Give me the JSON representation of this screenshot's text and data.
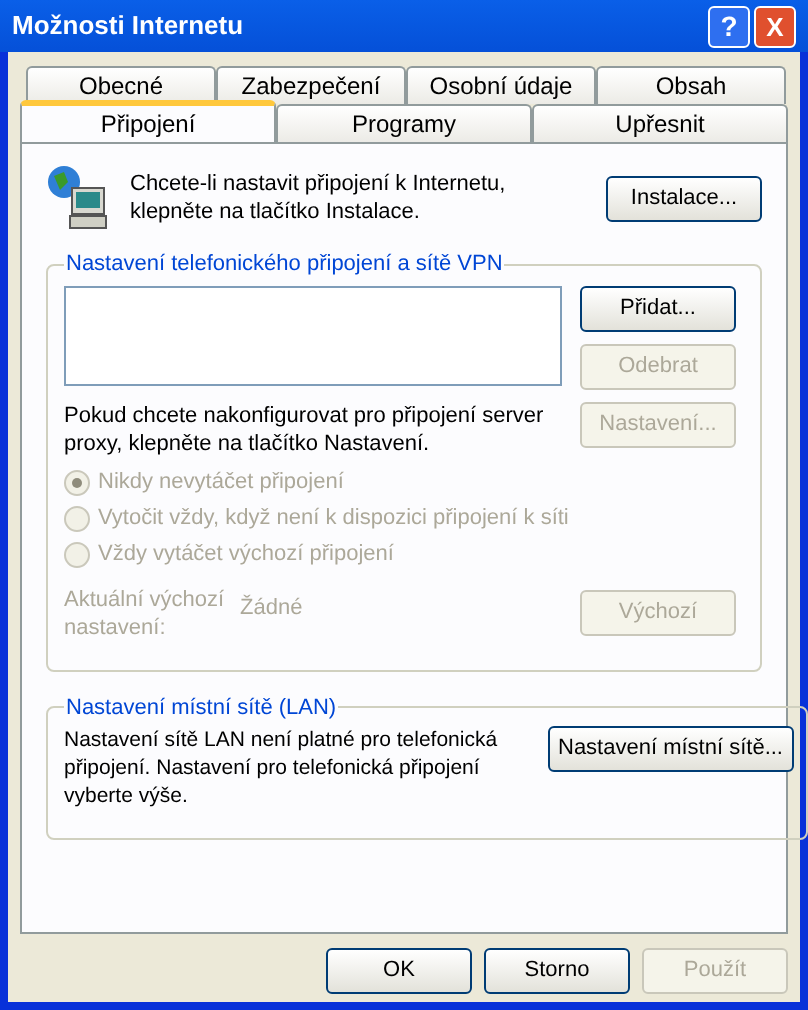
{
  "window": {
    "title": "Možnosti Internetu",
    "help_button": "?",
    "close_button": "X"
  },
  "tab_rows": [
    [
      {
        "label": "Obecné",
        "selected": false
      },
      {
        "label": "Zabezpečení",
        "selected": false
      },
      {
        "label": "Osobní údaje",
        "selected": false
      },
      {
        "label": "Obsah",
        "selected": false
      }
    ],
    [
      {
        "label": "Připojení",
        "selected": true
      },
      {
        "label": "Programy",
        "selected": false
      },
      {
        "label": "Upřesnit",
        "selected": false
      }
    ]
  ],
  "setup": {
    "text": "Chcete-li nastavit připojení k Internetu, klepněte na tlačítko Instalace.",
    "button": {
      "label": "Instalace...",
      "disabled": false
    }
  },
  "dialup_group": {
    "title": "Nastavení telefonického připojení a sítě VPN",
    "buttons": [
      {
        "label": "Přidat...",
        "disabled": false
      },
      {
        "label": "Odebrat",
        "disabled": true
      }
    ],
    "proxy_text": "Pokud chcete nakonfigurovat pro připojení server proxy, klepněte na tlačítko Nastavení.",
    "proxy_button": {
      "label": "Nastavení...",
      "disabled": true
    },
    "options": [
      {
        "label": "Nikdy nevytáčet připojení",
        "selected": true,
        "disabled": true
      },
      {
        "label": "Vytočit vždy, když není k dispozici připojení k síti",
        "selected": false,
        "disabled": true
      },
      {
        "label": "Vždy vytáčet výchozí připojení",
        "selected": false,
        "disabled": true
      }
    ],
    "default_label": "Aktuální výchozí nastavení:",
    "default_value": "Žádné",
    "default_disabled": true,
    "default_button": {
      "label": "Výchozí",
      "disabled": true
    }
  },
  "lan_group": {
    "title": "Nastavení místní sítě (LAN)",
    "text": "Nastavení sítě LAN není platné pro telefonická připojení. Nastavení pro telefonická připojení vyberte výše.",
    "button": {
      "label": "Nastavení místní sítě...",
      "disabled": false
    }
  },
  "footer_buttons": [
    {
      "label": "OK",
      "disabled": false
    },
    {
      "label": "Storno",
      "disabled": false
    },
    {
      "label": "Použít",
      "disabled": true
    }
  ]
}
